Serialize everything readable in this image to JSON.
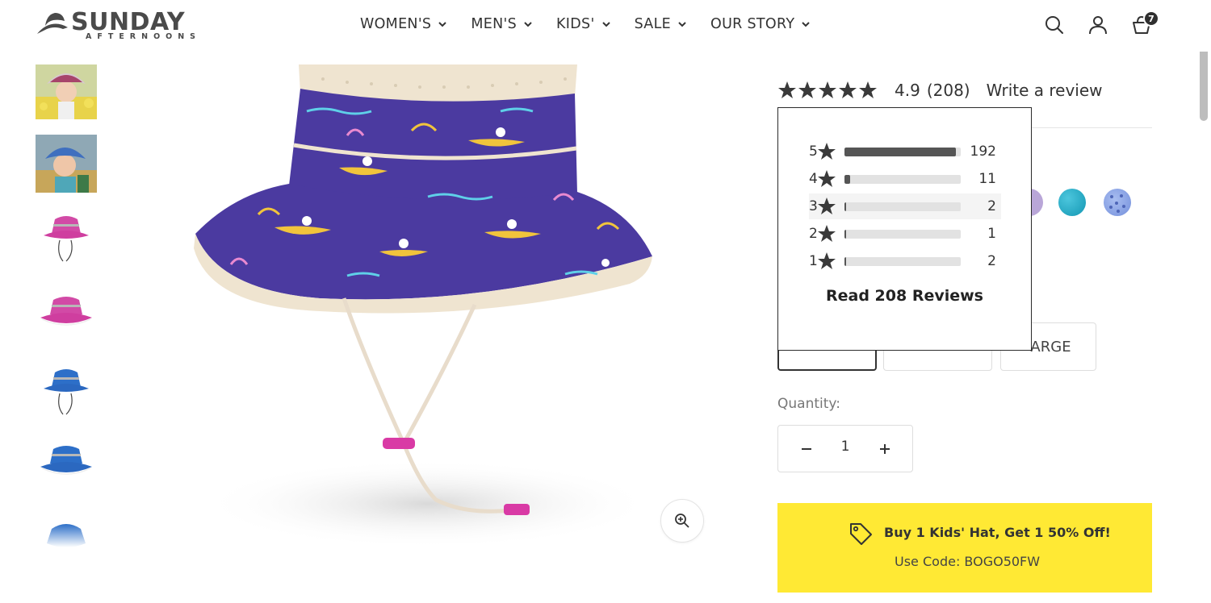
{
  "brand": {
    "name": "SUNDAY",
    "tagline": "AFTERNOONS"
  },
  "nav": [
    {
      "label": "WOMEN'S"
    },
    {
      "label": "MEN'S"
    },
    {
      "label": "KIDS'"
    },
    {
      "label": "SALE"
    },
    {
      "label": "OUR STORY"
    }
  ],
  "header": {
    "cart_count": "7",
    "icons": [
      "search-icon",
      "account-icon",
      "cart-icon"
    ]
  },
  "product": {
    "rating": "4.9",
    "review_count": "(208)",
    "write_review": "Write a review",
    "size_partial": "ARGE",
    "quantity_label": "Quantity:",
    "quantity": "1"
  },
  "rating_popup": {
    "rows": [
      {
        "stars": "5",
        "count": "192",
        "fraction": 0.96
      },
      {
        "stars": "4",
        "count": "11",
        "fraction": 0.05
      },
      {
        "stars": "3",
        "count": "2",
        "fraction": 0.01
      },
      {
        "stars": "2",
        "count": "1",
        "fraction": 0.005
      },
      {
        "stars": "1",
        "count": "2",
        "fraction": 0.01
      }
    ],
    "read_reviews": "Read 208 Reviews"
  },
  "promo": {
    "title": "Buy 1 Kids' Hat, Get 1 50% Off!",
    "code": "Use Code: BOGO50FW"
  },
  "colors": {
    "promo_bg": "#ffe934",
    "hat_purple": "#4b3aa0",
    "hat_trim": "#efe4d0",
    "swatch_teal": "#1ba4c0",
    "swatch_periwinkle": "#8aa6e8"
  }
}
